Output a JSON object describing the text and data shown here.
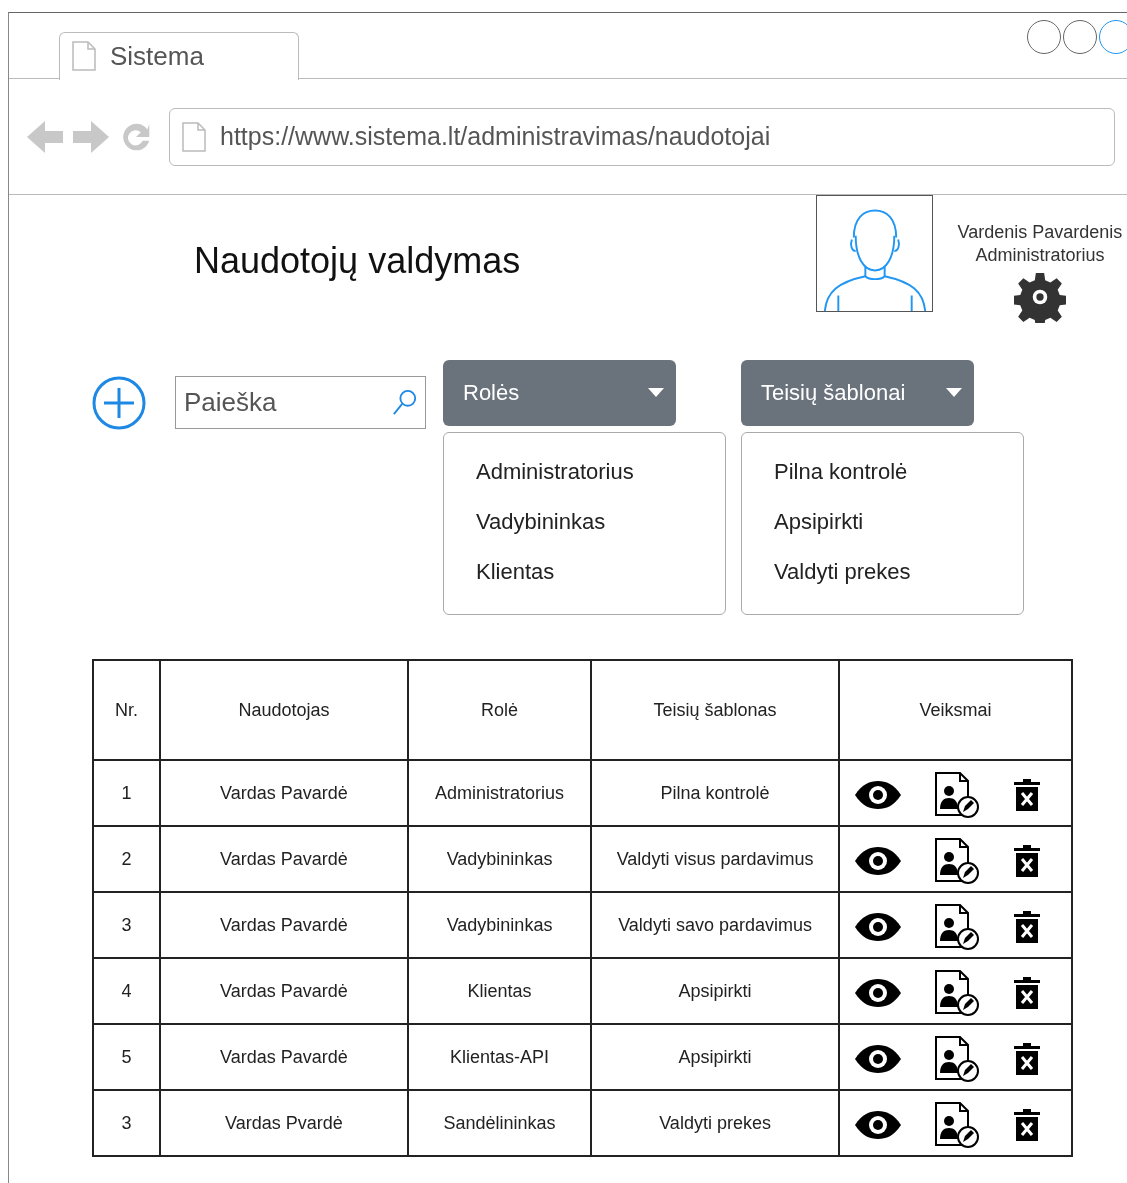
{
  "browser": {
    "tab_title": "Sistema",
    "url": "https://www.sistema.lt/administravimas/naudotojai"
  },
  "page_title": "Naudotojų valdymas",
  "user": {
    "name": "Vardenis Pavardenis",
    "role": "Administratorius"
  },
  "search": {
    "placeholder": "Paieška"
  },
  "dropdowns": [
    {
      "label": "Rolės",
      "expanded": true,
      "options": [
        "Administratorius",
        "Vadybininkas",
        "Klientas"
      ]
    },
    {
      "label": "Teisių šablonai",
      "expanded": true,
      "options": [
        "Pilna kontrolė",
        "Apsipirkti",
        "Valdyti prekes"
      ]
    }
  ],
  "table": {
    "columns": [
      "Nr.",
      "Naudotojas",
      "Rolė",
      "Teisių šablonas",
      "Veiksmai"
    ],
    "rows": [
      {
        "nr": "1",
        "user": "Vardas Pavardė",
        "role": "Administratorius",
        "template": "Pilna kontrolė"
      },
      {
        "nr": "2",
        "user": "Vardas Pavardė",
        "role": "Vadybininkas",
        "template": "Valdyti visus pardavimus"
      },
      {
        "nr": "3",
        "user": "Vardas Pavardė",
        "role": "Vadybininkas",
        "template": "Valdyti savo pardavimus"
      },
      {
        "nr": "4",
        "user": "Vardas Pavardė",
        "role": "Klientas",
        "template": "Apsipirkti"
      },
      {
        "nr": "5",
        "user": "Vardas Pavardė",
        "role": "Klientas-API",
        "template": "Apsipirkti"
      },
      {
        "nr": "3",
        "user": "Vardas Pvardė",
        "role": "Sandėlininkas",
        "template": "Valdyti prekes"
      }
    ]
  }
}
